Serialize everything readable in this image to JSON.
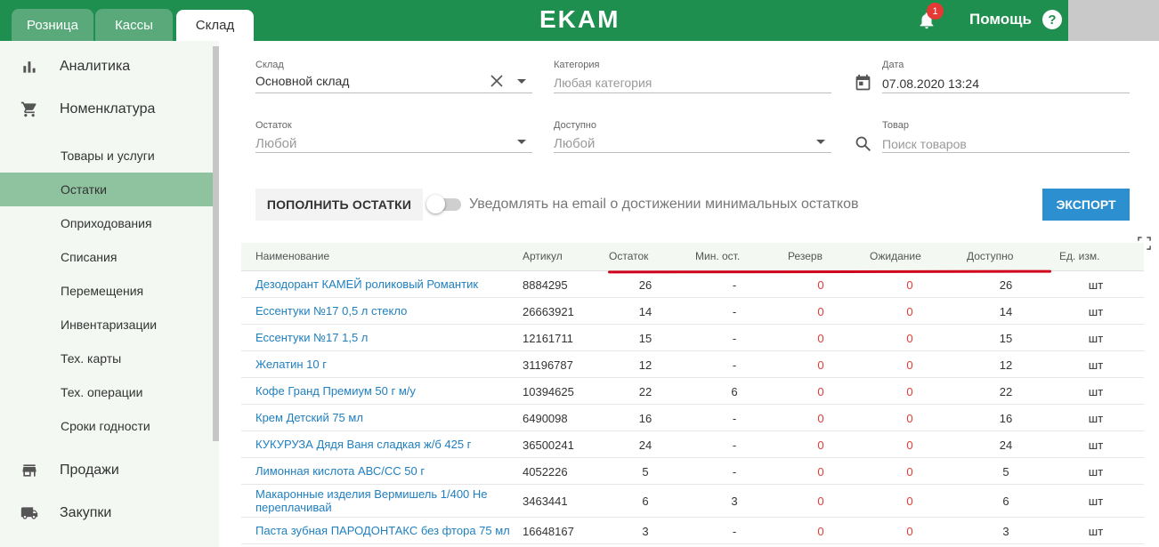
{
  "header": {
    "tabs": [
      "Розница",
      "Кассы",
      "Склад"
    ],
    "active_tab": "Склад",
    "logo": "EKAM",
    "notifications_count": "1",
    "help_label": "Помощь",
    "help_icon": "?"
  },
  "sidebar": {
    "main": [
      {
        "label": "Аналитика",
        "icon": "bar-chart-icon"
      },
      {
        "label": "Номенклатура",
        "icon": "cart-icon"
      }
    ],
    "sub": [
      "Товары и услуги",
      "Остатки",
      "Оприходования",
      "Списания",
      "Перемещения",
      "Инвентаризации",
      "Тех. карты",
      "Тех. операции",
      "Сроки годности"
    ],
    "active_sub": "Остатки",
    "main_bottom": [
      {
        "label": "Продажи",
        "icon": "store-icon"
      },
      {
        "label": "Закупки",
        "icon": "truck-icon"
      }
    ]
  },
  "filters": {
    "warehouse": {
      "label": "Склад",
      "value": "Основной склад"
    },
    "category": {
      "label": "Категория",
      "placeholder": "Любая категория"
    },
    "date": {
      "label": "Дата",
      "value": "07.08.2020 13:24"
    },
    "balance": {
      "label": "Остаток",
      "placeholder": "Любой"
    },
    "available": {
      "label": "Доступно",
      "placeholder": "Любой"
    },
    "product": {
      "label": "Товар",
      "placeholder": "Поиск товаров"
    }
  },
  "actions": {
    "fill_label": "ПОПОЛНИТЬ ОСТАТКИ",
    "notify_label": "Уведомлять на email о достижении минимальных остатков",
    "notify_on": false,
    "export_label": "ЭКСПОРТ"
  },
  "table": {
    "columns": [
      "Наименование",
      "Артикул",
      "Остаток",
      "Мин. ост.",
      "Резерв",
      "Ожидание",
      "Доступно",
      "Ед. изм."
    ],
    "rows": [
      {
        "name": "Дезодорант КАМЕЙ роликовый Романтик",
        "sku": "8884295",
        "balance": "26",
        "min": "-",
        "reserve": "0",
        "waiting": "0",
        "available": "26",
        "unit": "шт"
      },
      {
        "name": "Ессентуки №17 0,5 л стекло",
        "sku": "26663921",
        "balance": "14",
        "min": "-",
        "reserve": "0",
        "waiting": "0",
        "available": "14",
        "unit": "шт"
      },
      {
        "name": "Ессентуки №17 1,5 л",
        "sku": "12161711",
        "balance": "15",
        "min": "-",
        "reserve": "0",
        "waiting": "0",
        "available": "15",
        "unit": "шт"
      },
      {
        "name": "Желатин 10 г",
        "sku": "31196787",
        "balance": "12",
        "min": "-",
        "reserve": "0",
        "waiting": "0",
        "available": "12",
        "unit": "шт"
      },
      {
        "name": "Кофе Гранд Премиум 50 г м/у",
        "sku": "10394625",
        "balance": "22",
        "min": "6",
        "reserve": "0",
        "waiting": "0",
        "available": "22",
        "unit": "шт"
      },
      {
        "name": "Крем Детский 75 мл",
        "sku": "6490098",
        "balance": "16",
        "min": "-",
        "reserve": "0",
        "waiting": "0",
        "available": "16",
        "unit": "шт"
      },
      {
        "name": "КУКУРУЗА Дядя Ваня сладкая ж/б 425 г",
        "sku": "36500241",
        "balance": "24",
        "min": "-",
        "reserve": "0",
        "waiting": "0",
        "available": "24",
        "unit": "шт"
      },
      {
        "name": "Лимонная кислота АВС/СС 50 г",
        "sku": "4052226",
        "balance": "5",
        "min": "-",
        "reserve": "0",
        "waiting": "0",
        "available": "5",
        "unit": "шт"
      },
      {
        "name": "Макаронные изделия Вермишель 1/400 Не переплачивай",
        "sku": "3463441",
        "balance": "6",
        "min": "3",
        "reserve": "0",
        "waiting": "0",
        "available": "6",
        "unit": "шт"
      },
      {
        "name": "Паста зубная ПАРОДОНТАКС без фтора 75 мл",
        "sku": "16648167",
        "balance": "3",
        "min": "-",
        "reserve": "0",
        "waiting": "0",
        "available": "3",
        "unit": "шт"
      }
    ]
  }
}
